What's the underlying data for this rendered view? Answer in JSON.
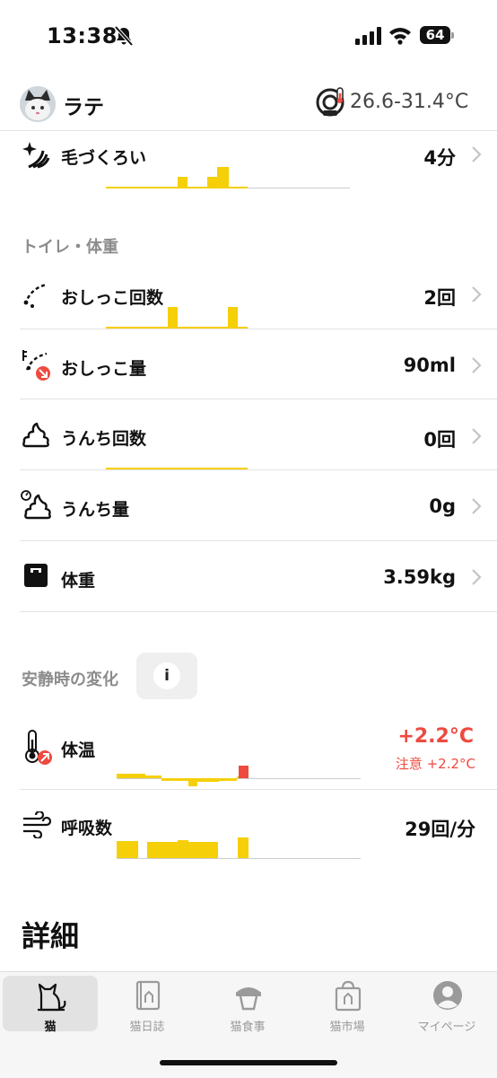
{
  "status_bar": {
    "time": "13:38",
    "battery": "64"
  },
  "header": {
    "cat_name": "ラテ",
    "temp_range": "26.6-31.4°C"
  },
  "grooming": {
    "label": "毛づくろい",
    "value": "4分"
  },
  "toilet_section": {
    "title": "トイレ・体重",
    "rows": [
      {
        "label": "おしっこ回数",
        "value": "2回"
      },
      {
        "label": "おしっこ量",
        "value": "90ml"
      },
      {
        "label": "うんち回数",
        "value": "0回"
      },
      {
        "label": "うんち量",
        "value": "0g"
      },
      {
        "label": "体重",
        "value": "3.59kg"
      }
    ]
  },
  "rest_section": {
    "title": "安静時の変化",
    "info_icon": "i",
    "temperature": {
      "label": "体温",
      "value": "+2.2°C",
      "note": "注意 +2.2°C"
    },
    "respiration": {
      "label": "呼吸数",
      "value": "29回/分"
    }
  },
  "details": {
    "title": "詳細"
  },
  "tabbar": {
    "tabs": [
      {
        "label": "猫",
        "icon": "cat-icon",
        "active": true
      },
      {
        "label": "猫日誌",
        "icon": "diary-icon",
        "active": false
      },
      {
        "label": "猫食事",
        "icon": "food-bowl-icon",
        "active": false
      },
      {
        "label": "猫市場",
        "icon": "shopping-bag-icon",
        "active": false
      },
      {
        "label": "マイページ",
        "icon": "person-icon",
        "active": false
      }
    ]
  },
  "colors": {
    "accent_yellow": "#f5cf08",
    "alert_red": "#ee4a40",
    "muted_gray": "#8c8c8c"
  }
}
